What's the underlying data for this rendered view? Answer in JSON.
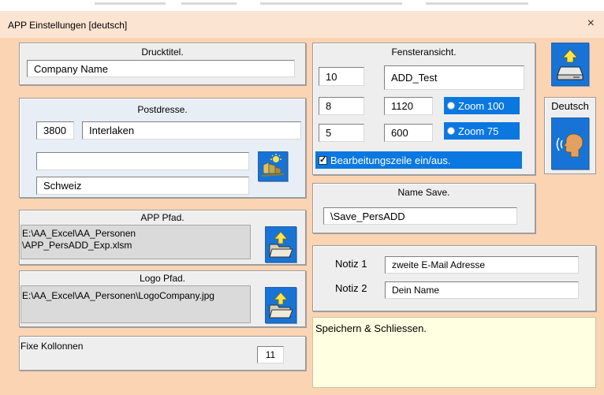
{
  "window": {
    "title": "APP Einstellungen   [deutsch]",
    "close_label": "×"
  },
  "druck": {
    "title": "Drucktitel.",
    "value": "Company Name"
  },
  "post": {
    "title": "Postdresse.",
    "zip": "3800",
    "city": "Interlaken",
    "line": "",
    "country": "Schweiz",
    "icon": "map-location-icon"
  },
  "app_pfad": {
    "title": "APP Pfad.",
    "line1": "E:\\AA_Excel\\AA_Personen",
    "line2": "\\APP_PersADD_Exp.xlsm",
    "icon": "folder-open-icon"
  },
  "logo_pfad": {
    "title": "Logo Pfad.",
    "line1": "E:\\AA_Excel\\AA_Personen\\LogoCompany.jpg",
    "icon": "folder-open-icon"
  },
  "fixe": {
    "label": "Fixe Kollonnen",
    "value": "11"
  },
  "fenster": {
    "title": "Fensteransicht.",
    "r1c1": "10",
    "r1c2": "ADD_Test",
    "r2c1": "8",
    "r2c2": "1120",
    "zoom100": "Zoom 100",
    "r3c1": "5",
    "r3c2": "600",
    "zoom75": "Zoom 75",
    "check_label": "Bearbeitungszeile ein/aus."
  },
  "name_save": {
    "title": "Name Save.",
    "value": "\\Save_PersADD"
  },
  "notiz": {
    "label1": "Notiz 1",
    "value1": "zweite E-Mail Adresse",
    "label2": "Notiz 2",
    "value2": "Dein Name"
  },
  "save_text": "Speichern & Schliessen.",
  "side": {
    "save_icon": "save-download-icon",
    "lang_label": "Deutsch",
    "lang_icon": "speaking-head-icon"
  },
  "colors": {
    "accent": "#1774d6",
    "client_bg": "#fbd4b4",
    "title_bg": "#fce4d2",
    "notes_bg": "#ffffe1"
  }
}
